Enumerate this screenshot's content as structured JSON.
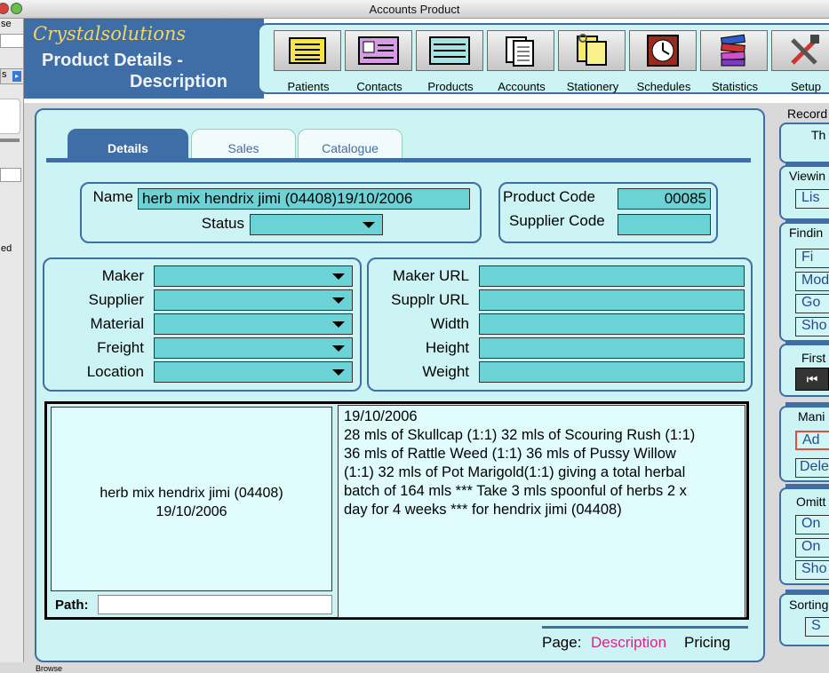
{
  "window": {
    "title": "Accounts Product"
  },
  "left_strip": {
    "fragment1": "se",
    "fragment2": "s",
    "fragment3": "ed",
    "fragment4": "Browse"
  },
  "header": {
    "brand": "Crystalsolutions",
    "page_title_line1": "Product Details -",
    "page_title_line2": "Description"
  },
  "nav": {
    "items": [
      {
        "label": "Patients",
        "icon": "patients-icon"
      },
      {
        "label": "Contacts",
        "icon": "contacts-icon"
      },
      {
        "label": "Products",
        "icon": "products-icon"
      },
      {
        "label": "Accounts",
        "icon": "accounts-icon"
      },
      {
        "label": "Stationery",
        "icon": "stationery-icon"
      },
      {
        "label": "Schedules",
        "icon": "schedules-icon"
      },
      {
        "label": "Statistics",
        "icon": "statistics-icon"
      },
      {
        "label": "Setup",
        "icon": "setup-icon"
      }
    ]
  },
  "tabs": [
    {
      "label": "Details",
      "active": true
    },
    {
      "label": "Sales",
      "active": false
    },
    {
      "label": "Catalogue",
      "active": false
    }
  ],
  "product": {
    "name_label": "Name",
    "name_value": "herb mix hendrix  jimi (04408)19/10/2006",
    "status_label": "Status",
    "status_value": "",
    "code_label": "Product Code",
    "code_value": "00085",
    "supplier_code_label": "Supplier Code",
    "supplier_code_value": ""
  },
  "left_fields": [
    {
      "label": "Maker",
      "value": ""
    },
    {
      "label": "Supplier",
      "value": ""
    },
    {
      "label": "Material",
      "value": ""
    },
    {
      "label": "Freight",
      "value": ""
    },
    {
      "label": "Location",
      "value": ""
    }
  ],
  "right_fields": [
    {
      "label": "Maker URL",
      "value": ""
    },
    {
      "label": "Supplr URL",
      "value": ""
    },
    {
      "label": "Width",
      "value": ""
    },
    {
      "label": "Height",
      "value": ""
    },
    {
      "label": "Weight",
      "value": ""
    }
  ],
  "image": {
    "caption_line1": "herb mix hendrix  jimi (04408)",
    "caption_line2": "19/10/2006",
    "path_label": "Path:",
    "path_value": ""
  },
  "description": {
    "lines": [
      "19/10/2006",
      "28  mls of  Skullcap (1:1) 32  mls of  Scouring Rush (1:1)",
      "36  mls of  Rattle Weed (1:1) 36  mls of Pussy Willow",
      "(1:1) 32  mls of  Pot Marigold(1:1) giving a total herbal",
      "batch of  164 mls *** Take 3 mls spoonful of herbs 2 x",
      "day for 4 weeks ***  for hendrix  jimi (04408)"
    ]
  },
  "page_nav": {
    "label": "Page:",
    "current": "Description",
    "other": "Pricing"
  },
  "right_panel": {
    "records_label": "Record",
    "records_text": "Th",
    "viewing_label": "Viewin",
    "list_btn": "Lis",
    "finding_label": "Findin",
    "find_btn": "Fi",
    "modify_btn": "Mod",
    "go_btn": "Go",
    "show_btn": "Sho",
    "first_label": "First",
    "manip_label": "Mani",
    "add_btn": "Ad",
    "delete_btn": "Dele",
    "omit_label": "Omitt",
    "omit1_btn": "On",
    "omit2_btn": "On",
    "show2_btn": "Sho",
    "sorting_label": "Sorting",
    "sort_btn": "S"
  },
  "colors": {
    "accent": "#3f6da6",
    "panel": "#cdf4f4",
    "field": "#6bd3d6",
    "link": "#e0208c"
  }
}
